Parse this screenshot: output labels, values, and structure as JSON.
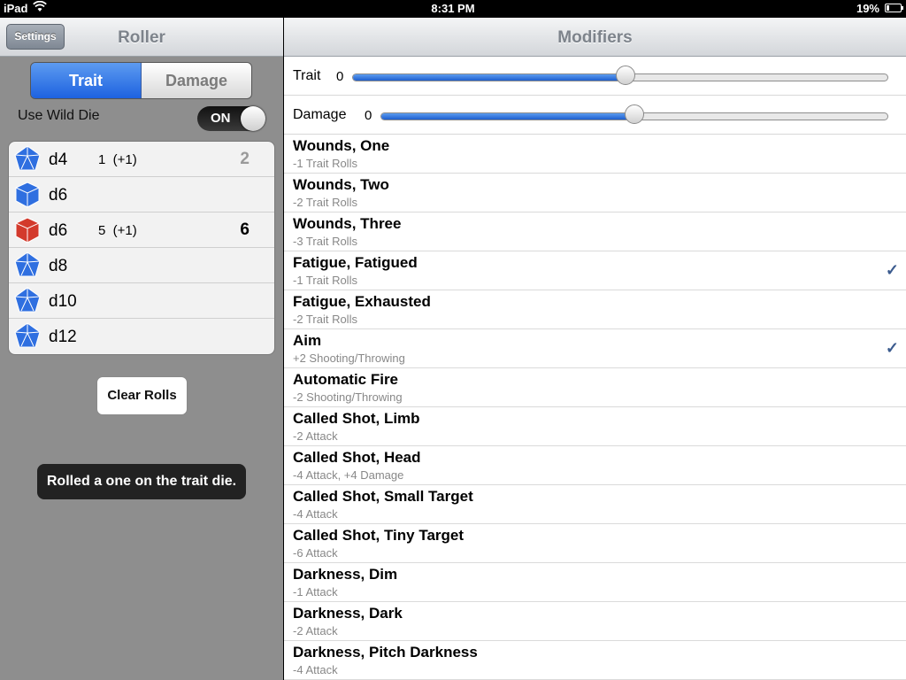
{
  "status_bar": {
    "device": "iPad",
    "time": "8:31 PM",
    "battery": "19%",
    "battery_level": 0.19
  },
  "left": {
    "settings_label": "Settings",
    "title": "Roller",
    "segments": [
      "Trait",
      "Damage"
    ],
    "selected_segment": "Trait",
    "wild_die_label": "Use Wild Die",
    "wild_die_toggle": "ON",
    "dice": [
      {
        "name": "d4",
        "roll": "1  (+1)",
        "total": "2",
        "color": "#2f6fe0",
        "total_color": "#9a9a9a",
        "icon": "d4-die-icon"
      },
      {
        "name": "d6",
        "roll": "",
        "total": "",
        "color": "#2f6fe0",
        "total_color": "#000000",
        "icon": "d6-die-icon"
      },
      {
        "name": "d6",
        "roll": "5  (+1)",
        "total": "6",
        "color": "#d33a2c",
        "total_color": "#000000",
        "icon": "d6-die-icon"
      },
      {
        "name": "d8",
        "roll": "",
        "total": "",
        "color": "#2f6fe0",
        "total_color": "#000000",
        "icon": "d8-die-icon"
      },
      {
        "name": "d10",
        "roll": "",
        "total": "",
        "color": "#2f6fe0",
        "total_color": "#000000",
        "icon": "d10-die-icon"
      },
      {
        "name": "d12",
        "roll": "",
        "total": "",
        "color": "#2f6fe0",
        "total_color": "#000000",
        "icon": "d12-die-icon"
      }
    ],
    "clear_label": "Clear Rolls",
    "toast": "Rolled a one on the trait die."
  },
  "right": {
    "title": "Modifiers",
    "trait_slider": {
      "label": "Trait",
      "value": "0",
      "level": 0.51
    },
    "damage_slider": {
      "label": "Damage",
      "value": "0",
      "level": 0.5
    },
    "modifiers": [
      {
        "name": "Wounds, One",
        "desc": "-1 Trait Rolls",
        "checked": false
      },
      {
        "name": "Wounds, Two",
        "desc": "-2 Trait Rolls",
        "checked": false
      },
      {
        "name": "Wounds, Three",
        "desc": "-3 Trait Rolls",
        "checked": false
      },
      {
        "name": "Fatigue, Fatigued",
        "desc": "-1 Trait Rolls",
        "checked": true
      },
      {
        "name": "Fatigue, Exhausted",
        "desc": "-2 Trait Rolls",
        "checked": false
      },
      {
        "name": "Aim",
        "desc": "+2 Shooting/Throwing",
        "checked": true
      },
      {
        "name": "Automatic Fire",
        "desc": "-2 Shooting/Throwing",
        "checked": false
      },
      {
        "name": "Called Shot, Limb",
        "desc": "-2 Attack",
        "checked": false
      },
      {
        "name": "Called Shot, Head",
        "desc": "-4 Attack, +4 Damage",
        "checked": false
      },
      {
        "name": "Called Shot, Small Target",
        "desc": "-4 Attack",
        "checked": false
      },
      {
        "name": "Called Shot, Tiny Target",
        "desc": "-6 Attack",
        "checked": false
      },
      {
        "name": "Darkness, Dim",
        "desc": "-1 Attack",
        "checked": false
      },
      {
        "name": "Darkness, Dark",
        "desc": "-2 Attack",
        "checked": false
      },
      {
        "name": "Darkness, Pitch Darkness",
        "desc": "-4 Attack",
        "checked": false
      }
    ],
    "check_mark": "✓"
  }
}
